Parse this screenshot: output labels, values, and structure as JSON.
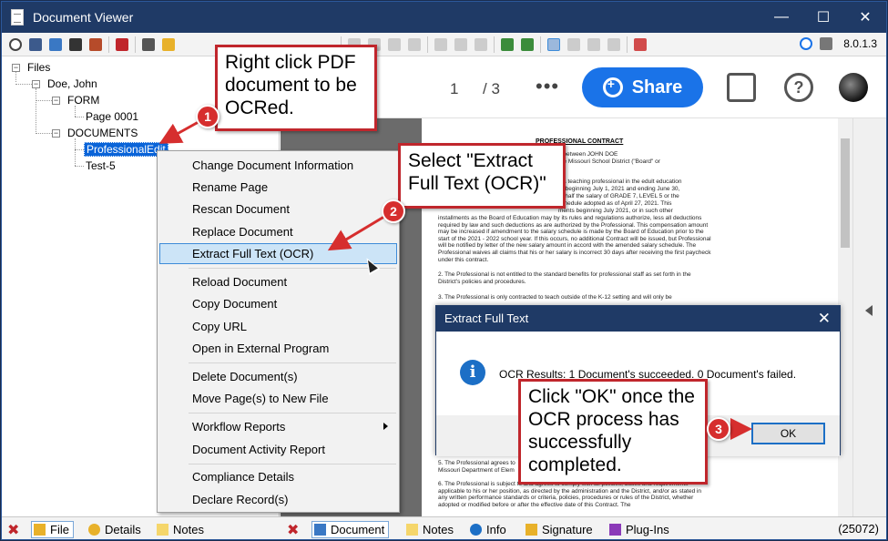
{
  "window": {
    "title": "Document Viewer",
    "minimize": "—",
    "maximize": "☐",
    "close": "✕"
  },
  "toolbar": {
    "version": "8.0.1.3"
  },
  "tree": {
    "root": "Files",
    "person": "Doe, John",
    "form_folder": "FORM",
    "page": "Page 0001",
    "documents_folder": "DOCUMENTS",
    "selected_doc": "ProfessionalEdit",
    "other_doc": "Test-5"
  },
  "viewer": {
    "page_current": "1",
    "page_total": "/ 3",
    "more": "•••",
    "share": "Share",
    "help": "?",
    "pdf_heading": "PROFESSIONAL CONTRACT",
    "pdf_p1": "d between JOHN DOE",
    "pdf_p1b": "the Missouri School District (\"Board\" or",
    "pdf_p2": "s a teaching professional in the edult education",
    "pdf_p2b": "ar beginning July 1, 2021 and ending June 30,",
    "pdf_p2c": "0, half the salary of GRADE 7, LEVEL 5 or the",
    "pdf_p2d": "schedule adopted as of April 27, 2021. This",
    "pdf_p2e": "ments beginning July 2021, or in such other",
    "pdf_p3": "installments as the Board of Education may by its rules and regulations authorize, less all deductions required by law and such deductions as are authorized by the Professional. This compensation amount may be increased if amendment to the salary schedule is made by the Board of Education prior to the start of the 2021 - 2022 school year. If this occurs, no additional Contract will be issued, but Professional will be notified by letter of the new salary amount in accord with the amended salary schedule. The Professional waives all claims that his or her salary is incorrect 30 days after receiving the first paycheck under this contract.",
    "pdf_p4": "2. The Professional is not entitled to the standard benefits for professional staff as set forth in the District's policies and procedures.",
    "pdf_p5": "3. The Professional is only contracted to teach outside of the K-12 setting and will only be",
    "pdf_p6": "5. The Professional agrees to",
    "pdf_p6b": "Missouri Department of Elem",
    "pdf_p7": "6. The Professional is subject to and agrees to comply with all policies, duties and requirements applicable to his or her position, as directed by the administration and the District, and/or as stated in any written performance standards or criteria, policies, procedures or rules of the District, whether adopted or modified before or after the effective date of this Contract. The"
  },
  "context_menu": {
    "items": [
      "Change Document Information",
      "Rename Page",
      "Rescan Document",
      "Replace Document",
      "Extract Full Text (OCR)",
      "Reload Document",
      "Copy Document",
      "Copy URL",
      "Open in External Program",
      "Delete Document(s)",
      "Move Page(s) to New File",
      "Workflow Reports",
      "Document Activity Report",
      "Compliance Details",
      "Declare Record(s)"
    ]
  },
  "dialog": {
    "title": "Extract Full Text",
    "close": "✕",
    "icon": "i",
    "message": "OCR Results: 1 Document's succeeded.  0 Document's failed.",
    "ok": "OK"
  },
  "callouts": {
    "c1": "Right click PDF document to be OCRed.",
    "c2": "Select \"Extract Full Text (OCR)\"",
    "c3": "Click \"OK\" once the OCR process has successfully completed.",
    "b1": "1",
    "b2": "2",
    "b3": "3"
  },
  "statusbar": {
    "file": "File",
    "details": "Details",
    "notes_left": "Notes",
    "document": "Document",
    "notes_right": "Notes",
    "info": "Info",
    "signature": "Signature",
    "plugins": "Plug-Ins",
    "count": "(25072)"
  },
  "colors": {
    "titlebar": "#1f3a66",
    "accent": "#1a73e8",
    "callout_border": "#c0262c",
    "badge": "#d62e2e"
  }
}
